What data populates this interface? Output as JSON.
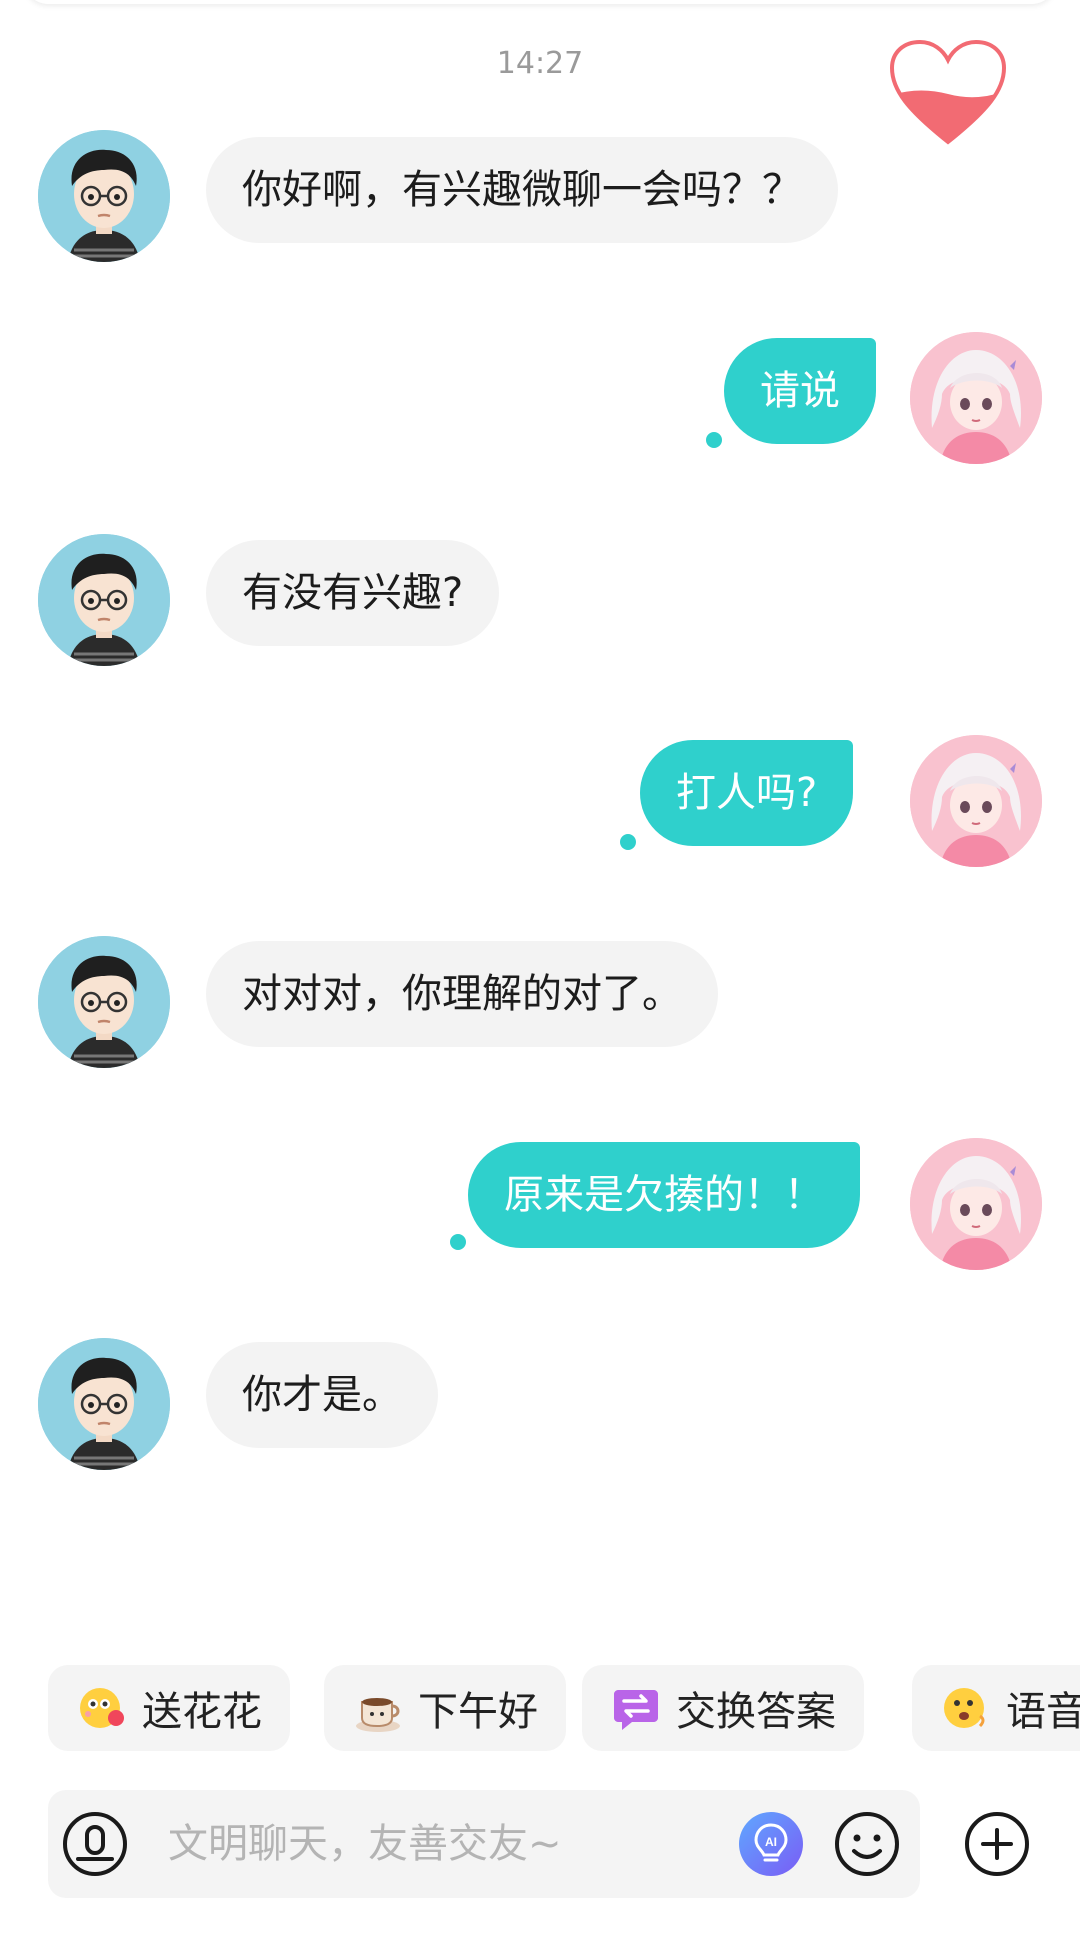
{
  "chat": {
    "timestamp": "14:27",
    "messages": [
      {
        "from": "other",
        "text": "你好啊，有兴趣微聊一会吗？？"
      },
      {
        "from": "me",
        "text": "请说"
      },
      {
        "from": "other",
        "text": "有没有兴趣?"
      },
      {
        "from": "me",
        "text": "打人吗?"
      },
      {
        "from": "other",
        "text": "对对对，你理解的对了。"
      },
      {
        "from": "me",
        "text": "原来是欠揍的！！"
      },
      {
        "from": "other",
        "text": "你才是。"
      }
    ]
  },
  "quick_replies": [
    {
      "label": "送花花",
      "icon": "flower-emoji-icon"
    },
    {
      "label": "下午好",
      "icon": "coffee-icon"
    },
    {
      "label": "交换答案",
      "icon": "exchange-icon"
    },
    {
      "label": "语音",
      "icon": "voice-emoji-icon"
    }
  ],
  "composer": {
    "placeholder": "文明聊天，友善交友~",
    "icons": [
      "voice-mode-icon",
      "ai-bulb-icon",
      "emoji-smile-icon",
      "plus-icon"
    ]
  },
  "colors": {
    "outgoing_bubble": "#2fd0cc",
    "incoming_bubble": "#f3f3f3",
    "heart": "#f26b73"
  }
}
